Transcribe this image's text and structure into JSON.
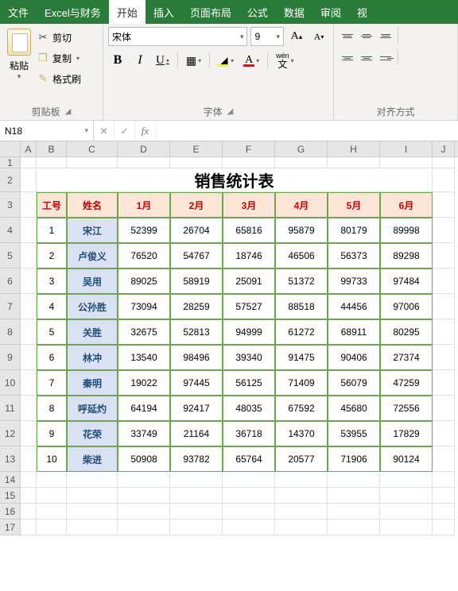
{
  "menubar": {
    "tabs": [
      "文件",
      "Excel与财务",
      "开始",
      "插入",
      "页面布局",
      "公式",
      "数据",
      "审阅",
      "视"
    ],
    "active_index": 2
  },
  "ribbon": {
    "clipboard": {
      "paste": "粘贴",
      "cut": "剪切",
      "copy": "复制",
      "format_painter": "格式刷",
      "group_label": "剪贴板"
    },
    "font": {
      "name": "宋体",
      "size": "9",
      "group_label": "字体",
      "wen_label": "wén"
    },
    "align": {
      "group_label": "对齐方式"
    }
  },
  "formula_bar": {
    "name_box": "N18",
    "fx": "fx",
    "value": ""
  },
  "grid": {
    "col_letters": [
      "A",
      "B",
      "C",
      "D",
      "E",
      "F",
      "G",
      "H",
      "I",
      "J"
    ],
    "row_heights": {
      "title": 32,
      "header": 32,
      "data": 32,
      "thin": 18,
      "first": 14
    },
    "table": {
      "title": "销售统计表",
      "headers": [
        "工号",
        "姓名",
        "1月",
        "2月",
        "3月",
        "4月",
        "5月",
        "6月"
      ],
      "rows": [
        {
          "id": "1",
          "name": "宋江",
          "v": [
            "52399",
            "26704",
            "65816",
            "95879",
            "80179",
            "89998"
          ]
        },
        {
          "id": "2",
          "name": "卢俊义",
          "v": [
            "76520",
            "54767",
            "18746",
            "46506",
            "56373",
            "89298"
          ]
        },
        {
          "id": "3",
          "name": "吴用",
          "v": [
            "89025",
            "58919",
            "25091",
            "51372",
            "99733",
            "97484"
          ]
        },
        {
          "id": "4",
          "name": "公孙胜",
          "v": [
            "73094",
            "28259",
            "57527",
            "88518",
            "44456",
            "97006"
          ]
        },
        {
          "id": "5",
          "name": "关胜",
          "v": [
            "32675",
            "52813",
            "94999",
            "61272",
            "68911",
            "80295"
          ]
        },
        {
          "id": "6",
          "name": "林冲",
          "v": [
            "13540",
            "98496",
            "39340",
            "91475",
            "90406",
            "27374"
          ]
        },
        {
          "id": "7",
          "name": "秦明",
          "v": [
            "19022",
            "97445",
            "56125",
            "71409",
            "56079",
            "47259"
          ]
        },
        {
          "id": "8",
          "name": "呼延灼",
          "v": [
            "64194",
            "92417",
            "48035",
            "67592",
            "45680",
            "72556"
          ]
        },
        {
          "id": "9",
          "name": "花荣",
          "v": [
            "33749",
            "21164",
            "36718",
            "14370",
            "53955",
            "17829"
          ]
        },
        {
          "id": "10",
          "name": "柴进",
          "v": [
            "50908",
            "93782",
            "65764",
            "20577",
            "71906",
            "90124"
          ]
        }
      ]
    }
  }
}
